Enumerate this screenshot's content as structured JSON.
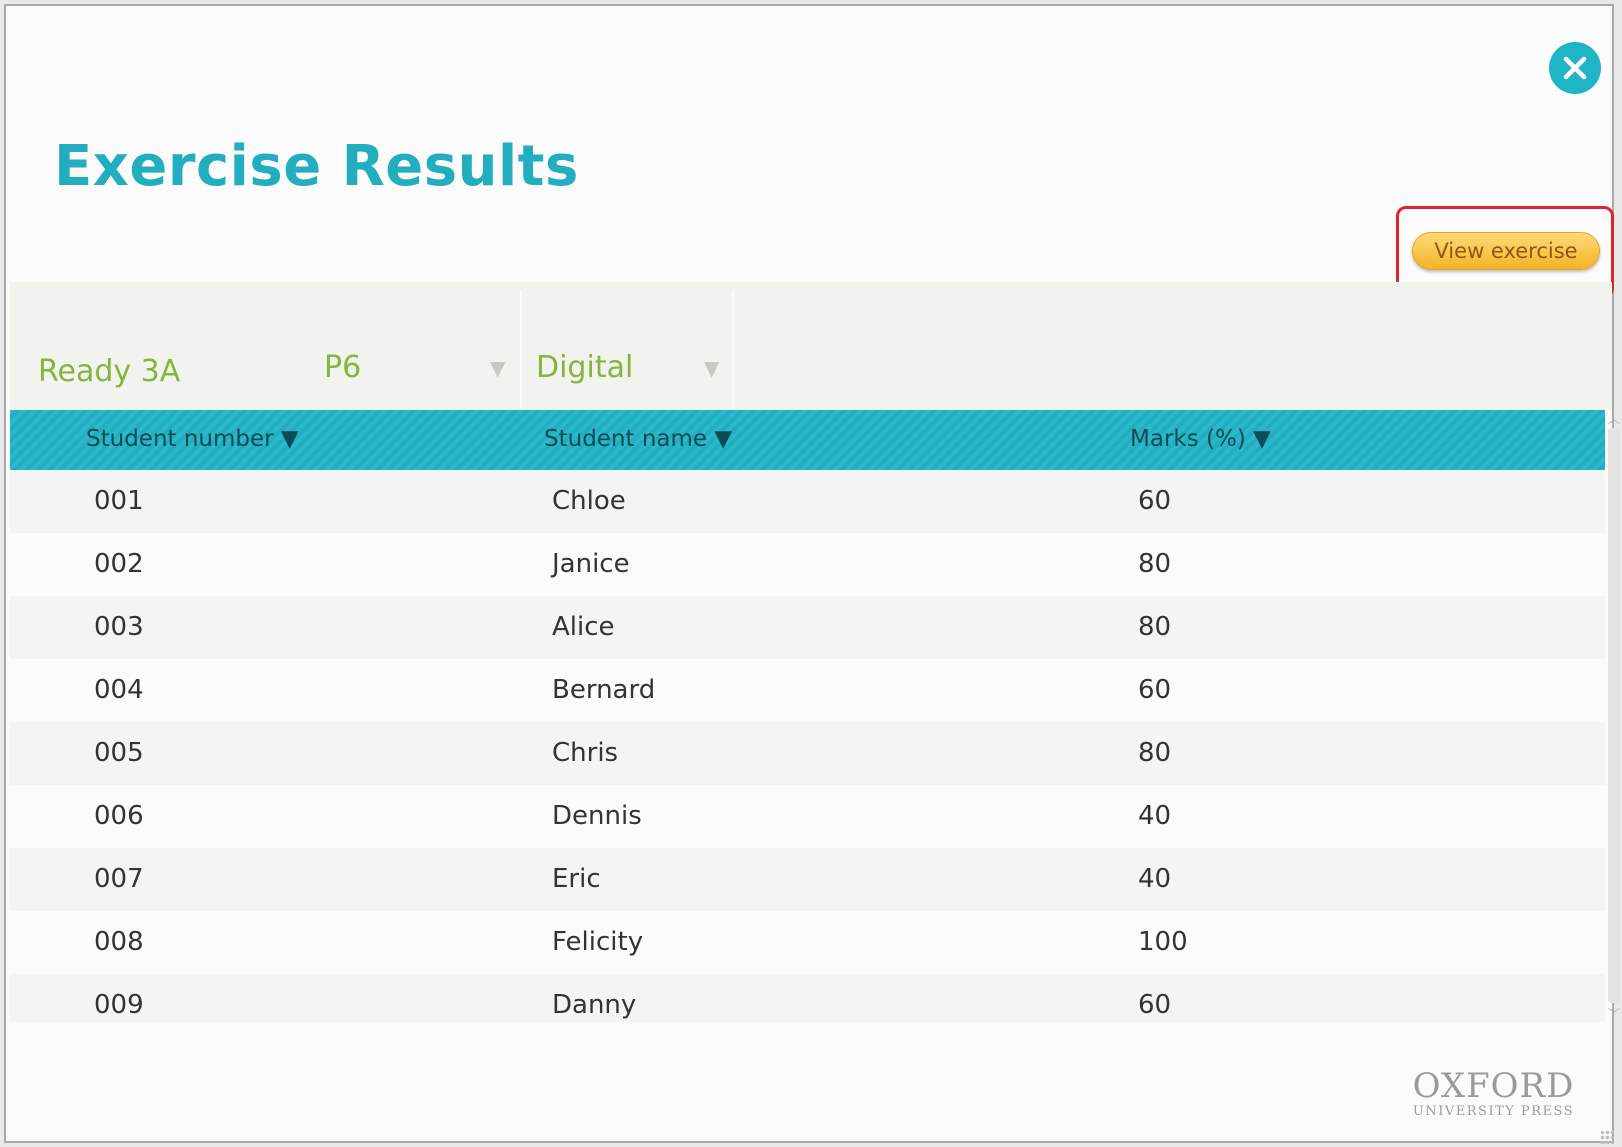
{
  "header": {
    "title": "Exercise Results",
    "view_button_label": "View exercise"
  },
  "filters": {
    "class_name": "Ready 3A",
    "grade": "P6",
    "mode": "Digital"
  },
  "table": {
    "columns": [
      "Student number ▼",
      "Student name ▼",
      "Marks (%) ▼"
    ],
    "rows": [
      {
        "number": "001",
        "name": "Chloe",
        "marks": "60"
      },
      {
        "number": "002",
        "name": "Janice",
        "marks": "80"
      },
      {
        "number": "003",
        "name": "Alice",
        "marks": "80"
      },
      {
        "number": "004",
        "name": "Bernard",
        "marks": "60"
      },
      {
        "number": "005",
        "name": "Chris",
        "marks": "80"
      },
      {
        "number": "006",
        "name": "Dennis",
        "marks": "40"
      },
      {
        "number": "007",
        "name": "Eric",
        "marks": "40"
      },
      {
        "number": "008",
        "name": "Felicity",
        "marks": "100"
      },
      {
        "number": "009",
        "name": "Danny",
        "marks": "60"
      }
    ]
  },
  "logo": {
    "main": "OXFORD",
    "sub": "UNIVERSITY PRESS"
  },
  "icons": {
    "close": "close-icon",
    "dropdown": "dropdown-arrow-icon"
  },
  "colors": {
    "accent": "#23aebf",
    "filter_text": "#8ab33d",
    "button": "#f5b32a",
    "highlight": "#e0242c"
  }
}
